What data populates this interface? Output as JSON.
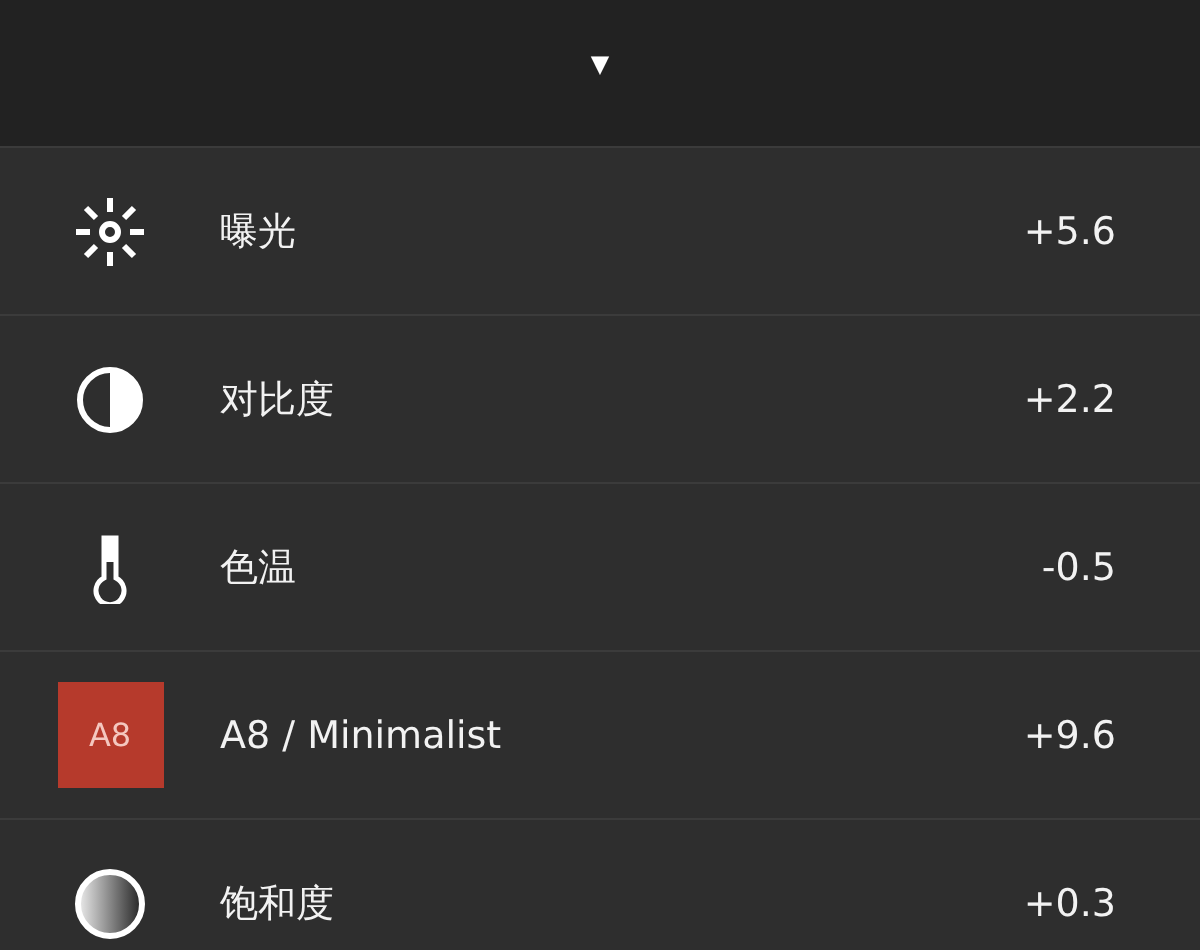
{
  "header": {
    "collapse_arrow": "▼"
  },
  "adjustments": [
    {
      "kind": "exposure",
      "label": "曝光",
      "value": "+5.6"
    },
    {
      "kind": "contrast",
      "label": "对比度",
      "value": "+2.2"
    },
    {
      "kind": "temperature",
      "label": "色温",
      "value": "-0.5"
    },
    {
      "kind": "preset",
      "badge": "A8",
      "color": "#b63a2c",
      "label": "A8 / Minimalist",
      "value": "+9.6"
    },
    {
      "kind": "saturation",
      "label": "饱和度",
      "value": "+0.3"
    }
  ]
}
